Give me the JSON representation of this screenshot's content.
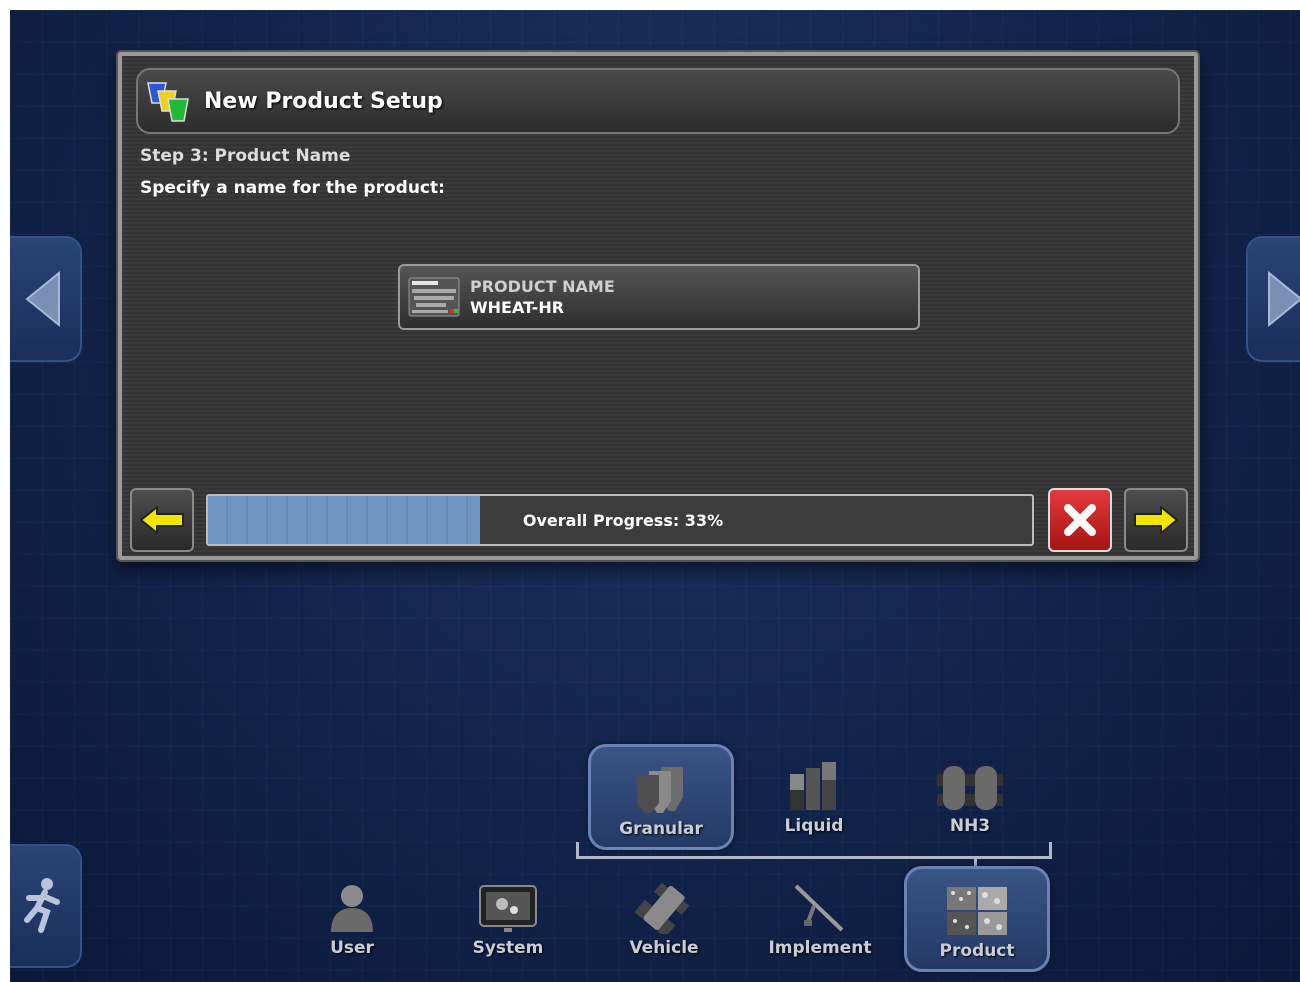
{
  "dialog": {
    "title": "New Product Setup",
    "step_title": "Step 3: Product Name",
    "instruction": "Specify a name for the product:",
    "field": {
      "label": "PRODUCT NAME",
      "value": "WHEAT-HR"
    },
    "progress": {
      "label": "Overall Progress: 33%",
      "percent": 33
    }
  },
  "product_types": [
    {
      "label": "Granular",
      "icon": "granular-icon",
      "selected": true
    },
    {
      "label": "Liquid",
      "icon": "liquid-icon",
      "selected": false
    },
    {
      "label": "NH3",
      "icon": "nh3-icon",
      "selected": false
    }
  ],
  "main_menu": [
    {
      "label": "User",
      "icon": "user-icon"
    },
    {
      "label": "System",
      "icon": "system-icon"
    },
    {
      "label": "Vehicle",
      "icon": "vehicle-icon"
    },
    {
      "label": "Implement",
      "icon": "implement-icon"
    },
    {
      "label": "Product",
      "icon": "product-icon",
      "selected": true
    }
  ],
  "colors": {
    "accent_blue": "#6f95c4",
    "cancel_red": "#d02020",
    "arrow_yellow": "#f2e400"
  }
}
